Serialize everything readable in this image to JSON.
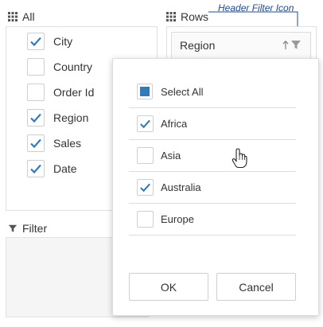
{
  "all_section": {
    "title": "All",
    "fields": [
      {
        "label": "City",
        "checked": true
      },
      {
        "label": "Country",
        "checked": false
      },
      {
        "label": "Order Id",
        "checked": false
      },
      {
        "label": "Region",
        "checked": true
      },
      {
        "label": "Sales",
        "checked": true
      },
      {
        "label": "Date",
        "checked": true
      }
    ]
  },
  "rows_section": {
    "title": "Rows",
    "field_label": "Region"
  },
  "filter_section": {
    "title": "Filter"
  },
  "annotation": {
    "text": "Header Filter Icon"
  },
  "filter_dropdown": {
    "select_all_label": "Select All",
    "select_all_state": "indeterminate",
    "items": [
      {
        "label": "Africa",
        "checked": true
      },
      {
        "label": "Asia",
        "checked": false
      },
      {
        "label": "Australia",
        "checked": true
      },
      {
        "label": "Europe",
        "checked": false
      }
    ],
    "ok_label": "OK",
    "cancel_label": "Cancel"
  },
  "colors": {
    "accent": "#337ab7",
    "annotation": "#1f4e8c",
    "border": "#e0e0e0"
  }
}
